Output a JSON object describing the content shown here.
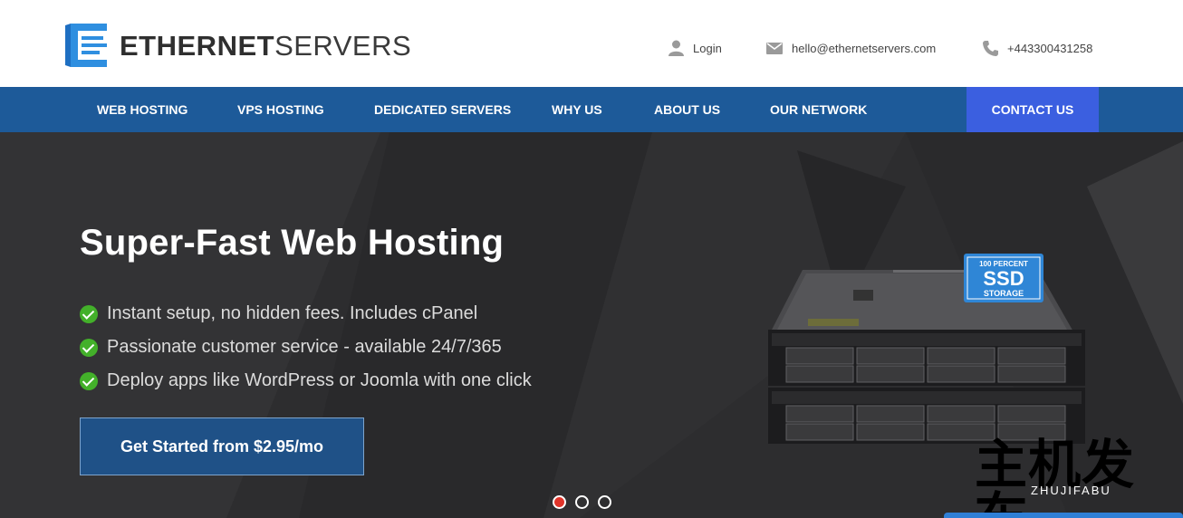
{
  "brand": {
    "name_bold": "ETHERNET",
    "name_light": "SERVERS",
    "accent": "#2f8fe0",
    "nav_bg": "#1d5a99",
    "cta_bg": "#3b5fe0"
  },
  "top_links": {
    "login": {
      "label": "Login",
      "icon": "user-icon"
    },
    "email": {
      "label": "hello@ethernetservers.com",
      "icon": "envelope-icon"
    },
    "phone": {
      "label": "+443300431258",
      "icon": "phone-icon"
    }
  },
  "nav": {
    "items": [
      {
        "label": "WEB HOSTING"
      },
      {
        "label": "VPS HOSTING"
      },
      {
        "label": "DEDICATED SERVERS"
      },
      {
        "label": "WHY US"
      },
      {
        "label": "ABOUT US"
      },
      {
        "label": "OUR NETWORK"
      }
    ],
    "contact": "CONTACT US"
  },
  "hero": {
    "title": "Super-Fast Web Hosting",
    "features": [
      "Instant setup, no hidden fees. Includes cPanel",
      "Passionate customer service - available 24/7/365",
      "Deploy apps like WordPress or Joomla with one click"
    ],
    "cta": "Get Started from $2.95/mo",
    "badge": {
      "top": "100 PERCENT",
      "main": "SSD",
      "bottom": "STORAGE"
    },
    "slides": {
      "count": 3,
      "active": 0
    }
  },
  "watermark": {
    "cn": "主机发布",
    "en": "ZHUJIFABU"
  }
}
